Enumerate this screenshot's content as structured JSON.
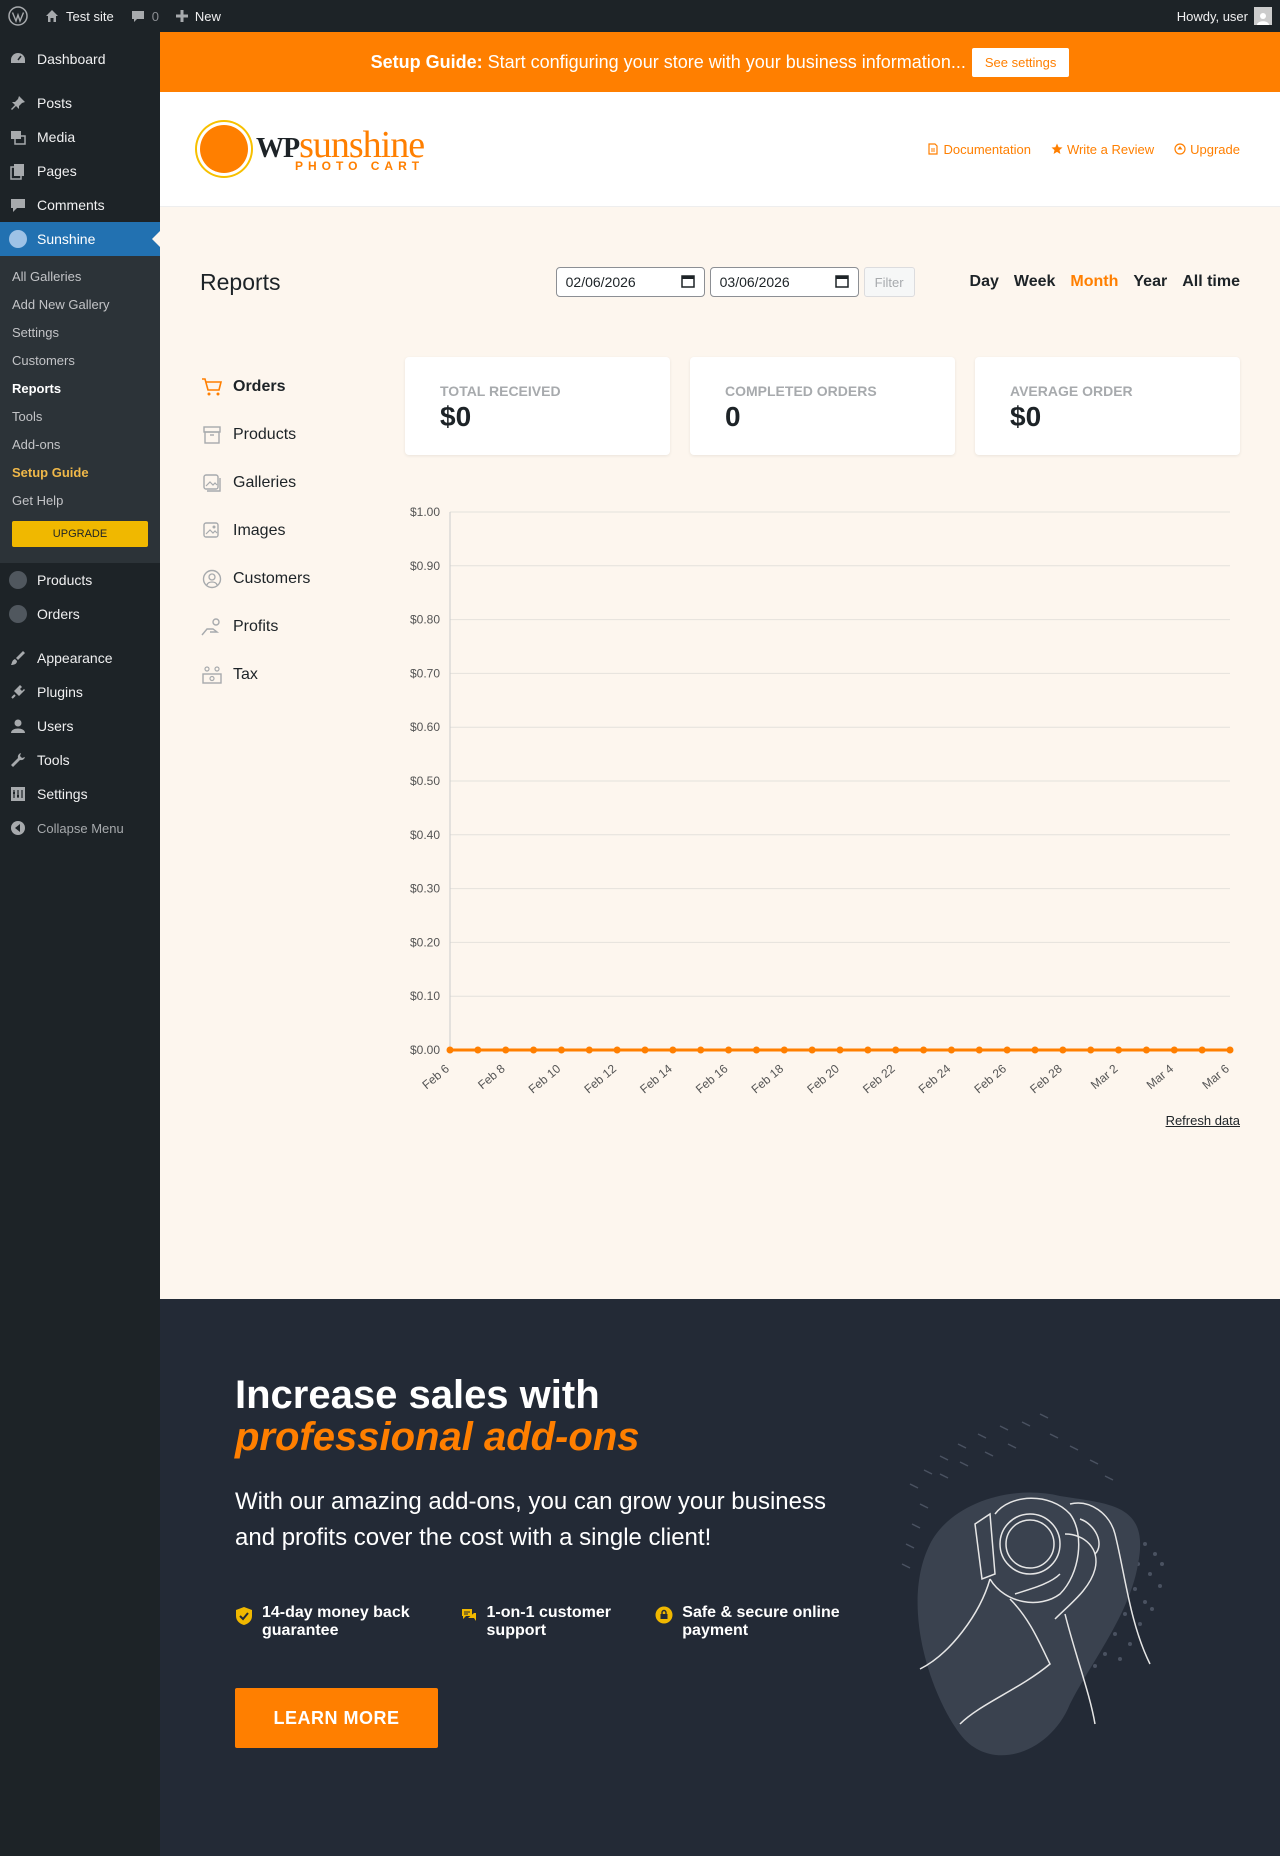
{
  "adminbar": {
    "site_name": "Test site",
    "comments_count": "0",
    "new_label": "New",
    "howdy": "Howdy, user"
  },
  "sidebar": {
    "items_top": [
      {
        "label": "Dashboard",
        "icon": "dashboard-icon"
      },
      {
        "label": "Posts",
        "icon": "pin-icon"
      },
      {
        "label": "Media",
        "icon": "media-icon"
      },
      {
        "label": "Pages",
        "icon": "pages-icon"
      },
      {
        "label": "Comments",
        "icon": "comment-icon"
      },
      {
        "label": "Sunshine",
        "icon": "sunshine-icon"
      }
    ],
    "submenu": [
      "All Galleries",
      "Add New Gallery",
      "Settings",
      "Customers",
      "Reports",
      "Tools",
      "Add-ons",
      "Setup Guide",
      "Get Help"
    ],
    "upgrade_label": "UPGRADE",
    "items_mid": [
      "Products",
      "Orders"
    ],
    "items_bottom": [
      "Appearance",
      "Plugins",
      "Users",
      "Tools",
      "Settings"
    ],
    "collapse_label": "Collapse Menu"
  },
  "banner": {
    "bold": "Setup Guide:",
    "text": "Start configuring your store with your business information...",
    "button": "See settings"
  },
  "header": {
    "logo_wp": "WP",
    "logo_sunshine": "sunshine",
    "logo_photo_cart": "PHOTO CART",
    "links": [
      "Documentation",
      "Write a Review",
      "Upgrade"
    ]
  },
  "reports": {
    "title": "Reports",
    "date_from": "02/06/2026",
    "date_to": "03/06/2026",
    "filter_label": "Filter",
    "ranges": [
      "Day",
      "Week",
      "Month",
      "Year",
      "All time"
    ],
    "active_range": "Month",
    "nav": [
      "Orders",
      "Products",
      "Galleries",
      "Images",
      "Customers",
      "Profits",
      "Tax"
    ],
    "active_nav": "Orders",
    "stats": [
      {
        "label": "TOTAL RECEIVED",
        "value": "$0"
      },
      {
        "label": "COMPLETED ORDERS",
        "value": "0"
      },
      {
        "label": "AVERAGE ORDER",
        "value": "$0"
      }
    ],
    "refresh_label": "Refresh data"
  },
  "chart_data": {
    "type": "line",
    "x": [
      "Feb 6",
      "Feb 7",
      "Feb 8",
      "Feb 9",
      "Feb 10",
      "Feb 11",
      "Feb 12",
      "Feb 13",
      "Feb 14",
      "Feb 15",
      "Feb 16",
      "Feb 17",
      "Feb 18",
      "Feb 19",
      "Feb 20",
      "Feb 21",
      "Feb 22",
      "Feb 23",
      "Feb 24",
      "Feb 25",
      "Feb 26",
      "Feb 27",
      "Feb 28",
      "Mar 1",
      "Mar 2",
      "Mar 3",
      "Mar 4",
      "Mar 5",
      "Mar 6"
    ],
    "x_tick_labels": [
      "Feb 6",
      "Feb 8",
      "Feb 10",
      "Feb 12",
      "Feb 14",
      "Feb 16",
      "Feb 18",
      "Feb 20",
      "Feb 22",
      "Feb 24",
      "Feb 26",
      "Feb 28",
      "Mar 2",
      "Mar 4",
      "Mar 6"
    ],
    "series": [
      {
        "values": [
          0,
          0,
          0,
          0,
          0,
          0,
          0,
          0,
          0,
          0,
          0,
          0,
          0,
          0,
          0,
          0,
          0,
          0,
          0,
          0,
          0,
          0,
          0,
          0,
          0,
          0,
          0,
          0,
          0
        ]
      }
    ],
    "y_tick_labels": [
      "$0.00",
      "$0.10",
      "$0.20",
      "$0.30",
      "$0.40",
      "$0.50",
      "$0.60",
      "$0.70",
      "$0.80",
      "$0.90",
      "$1.00"
    ],
    "ylim": [
      0,
      1
    ],
    "grid": true,
    "line_color": "#ff7f00"
  },
  "promo": {
    "title_line1": "Increase sales with",
    "title_line2": "professional add-ons",
    "paragraph": "With our amazing add-ons, you can grow your business and profits cover the cost with a single client!",
    "features": [
      "14-day money back guarantee",
      "1-on-1 customer support",
      "Safe & secure online payment"
    ],
    "button": "LEARN MORE"
  },
  "colors": {
    "accent": "#ff7f00",
    "admin_dark": "#1d2327",
    "active_blue": "#2271b1",
    "promo_bg": "#232a36"
  }
}
